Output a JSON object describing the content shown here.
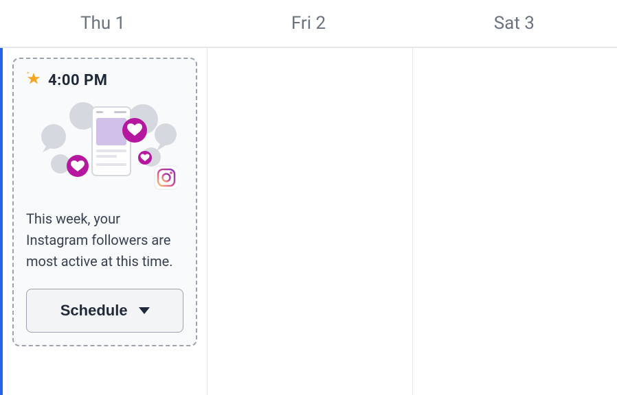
{
  "days": [
    {
      "label": "Thu 1"
    },
    {
      "label": "Fri 2"
    },
    {
      "label": "Sat 3"
    }
  ],
  "suggestion": {
    "time": "4:00 PM",
    "message": "This week, your Instagram followers are most active at this time.",
    "button_label": "Schedule",
    "icon_name": "star-icon",
    "platform_icon": "instagram-icon"
  },
  "colors": {
    "accent": "#b5179e",
    "active_day_border": "#2563eb"
  }
}
